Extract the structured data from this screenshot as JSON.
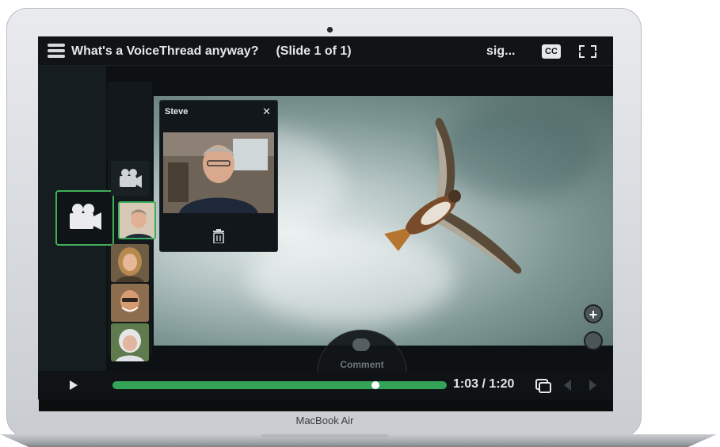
{
  "header": {
    "title": "What's a VoiceThread anyway?",
    "slide_info": "(Slide 1 of 1)",
    "user_label": "sig...",
    "cc_label": "CC"
  },
  "popup": {
    "commenter_name": "Steve",
    "close_symbol": "✕"
  },
  "comment": {
    "label": "Comment"
  },
  "zoom": {
    "plus_symbol": "+"
  },
  "playback": {
    "time": "1:03 / 1:20",
    "progress_fraction": 0.7875
  },
  "device": {
    "brand": "MacBook Air"
  },
  "icons": [
    "menu-icon",
    "cc-icon",
    "fullscreen-icon",
    "video-camera-icon",
    "trash-icon",
    "comment-icon",
    "play-icon",
    "copy-icon",
    "prev-arrow-icon",
    "next-arrow-icon"
  ],
  "colors": {
    "accent_green": "#3fae5a",
    "progress_green": "#36a458",
    "bar_dark": "#0f1315"
  }
}
